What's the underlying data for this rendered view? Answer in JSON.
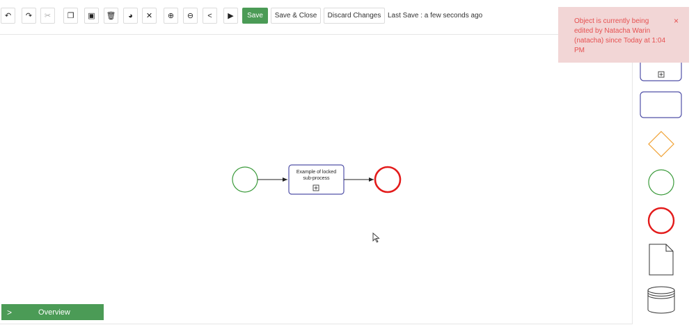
{
  "toolbar": {
    "icons": [
      {
        "name": "undo",
        "glyph": "↶"
      },
      {
        "name": "redo",
        "glyph": "↷"
      },
      {
        "name": "cut",
        "glyph": "✂"
      },
      {
        "name": "copy",
        "glyph": "❐"
      },
      {
        "name": "paste",
        "glyph": "▣"
      },
      {
        "name": "delete",
        "glyph": "🗑"
      },
      {
        "name": "palette",
        "glyph": "◕"
      },
      {
        "name": "fit",
        "glyph": "✕"
      },
      {
        "name": "zoom-in",
        "glyph": "⊕"
      },
      {
        "name": "zoom-out",
        "glyph": "⊖"
      },
      {
        "name": "share",
        "glyph": "<"
      },
      {
        "name": "run",
        "glyph": "▶"
      }
    ],
    "save_label": "Save",
    "save_close_label": "Save & Close",
    "discard_label": "Discard Changes",
    "last_save_text": "Last Save : a few seconds ago"
  },
  "toast": {
    "message": "Object is currently being edited by Natacha Warin (natacha) since Today at 1:04 PM",
    "close_glyph": "×"
  },
  "diagram": {
    "subprocess_label_line1": "Example of locked",
    "subprocess_label_line2": "sub-process",
    "start_color": "#3a9a3a",
    "end_color": "#e31b1b",
    "task_color": "#5151a8"
  },
  "palette": {
    "items": [
      "collapsed-subprocess",
      "task",
      "gateway",
      "start-event",
      "end-event",
      "data-object",
      "data-store"
    ],
    "gateway_color": "#f0a030"
  },
  "overview": {
    "label": "Overview",
    "chevron": ">"
  }
}
